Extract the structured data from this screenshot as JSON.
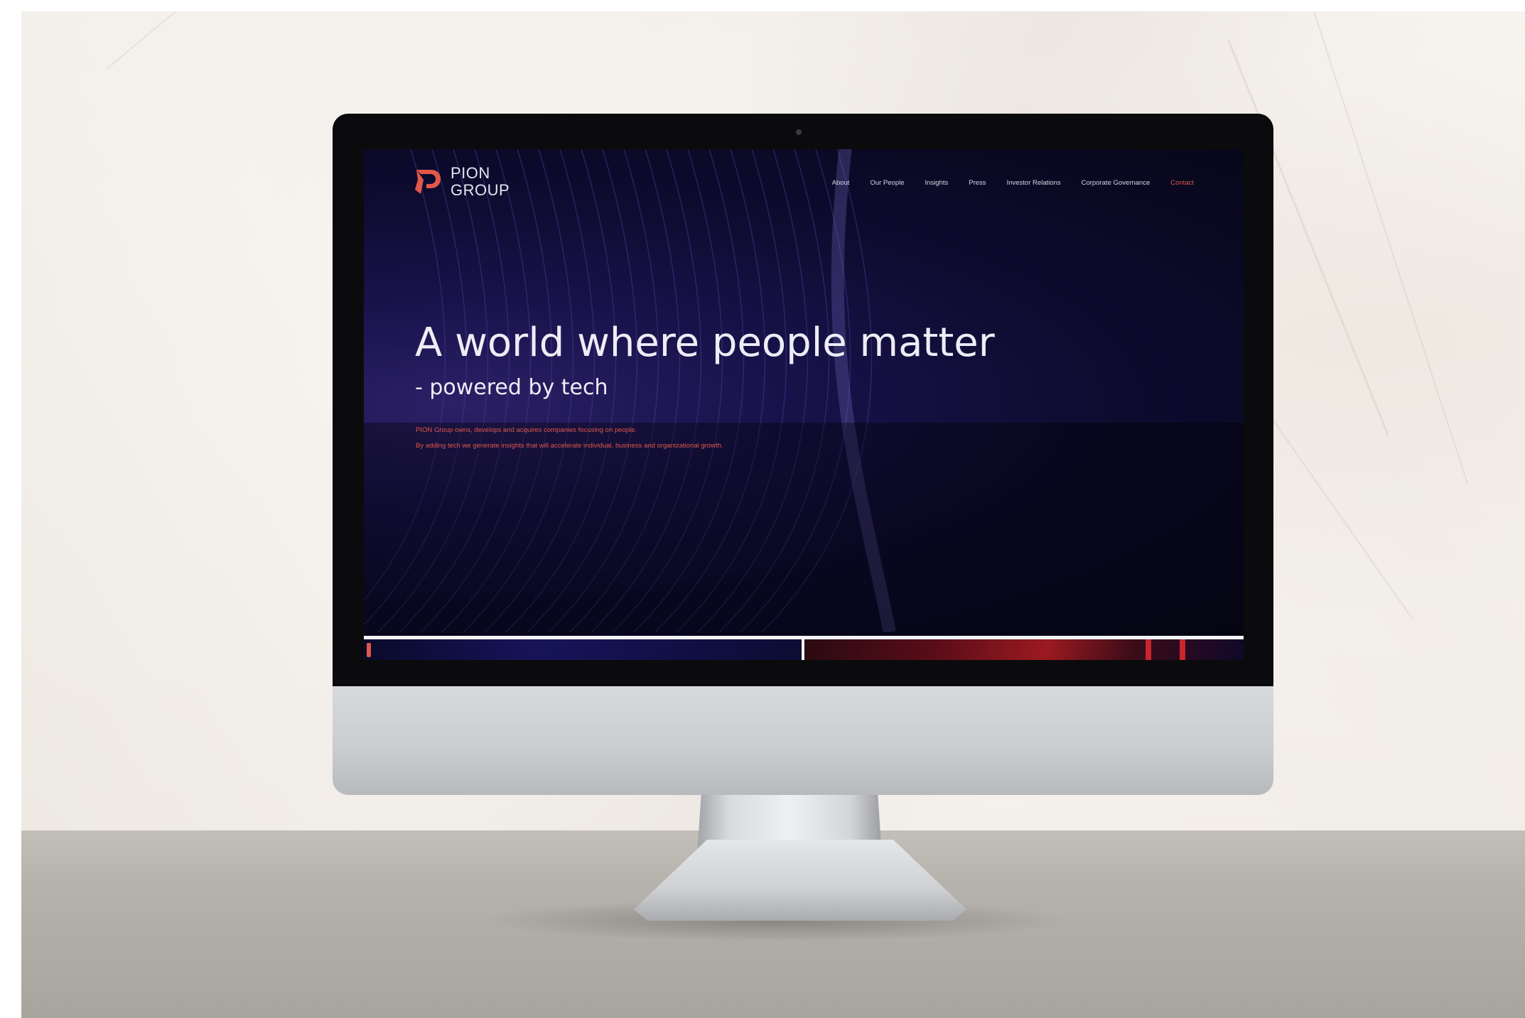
{
  "brand": {
    "line1": "PION",
    "line2": "GROUP",
    "logo_icon": "pion-p-logo-icon",
    "accent_color": "#e0584a"
  },
  "nav": {
    "items": [
      "About",
      "Our People",
      "Insights",
      "Press",
      "Investor Relations",
      "Corporate Governance"
    ],
    "contact": "Contact"
  },
  "hero": {
    "headline": "A world where people matter",
    "subhead": "- powered by tech",
    "body": [
      "PION Group owns, develops and acquires companies focusing on people.",
      "By adding tech we generate insights that will accelerate individual, business and organizational growth."
    ]
  },
  "colors": {
    "hero_background": "#0d0b2e",
    "text_primary": "#eeecf5"
  }
}
